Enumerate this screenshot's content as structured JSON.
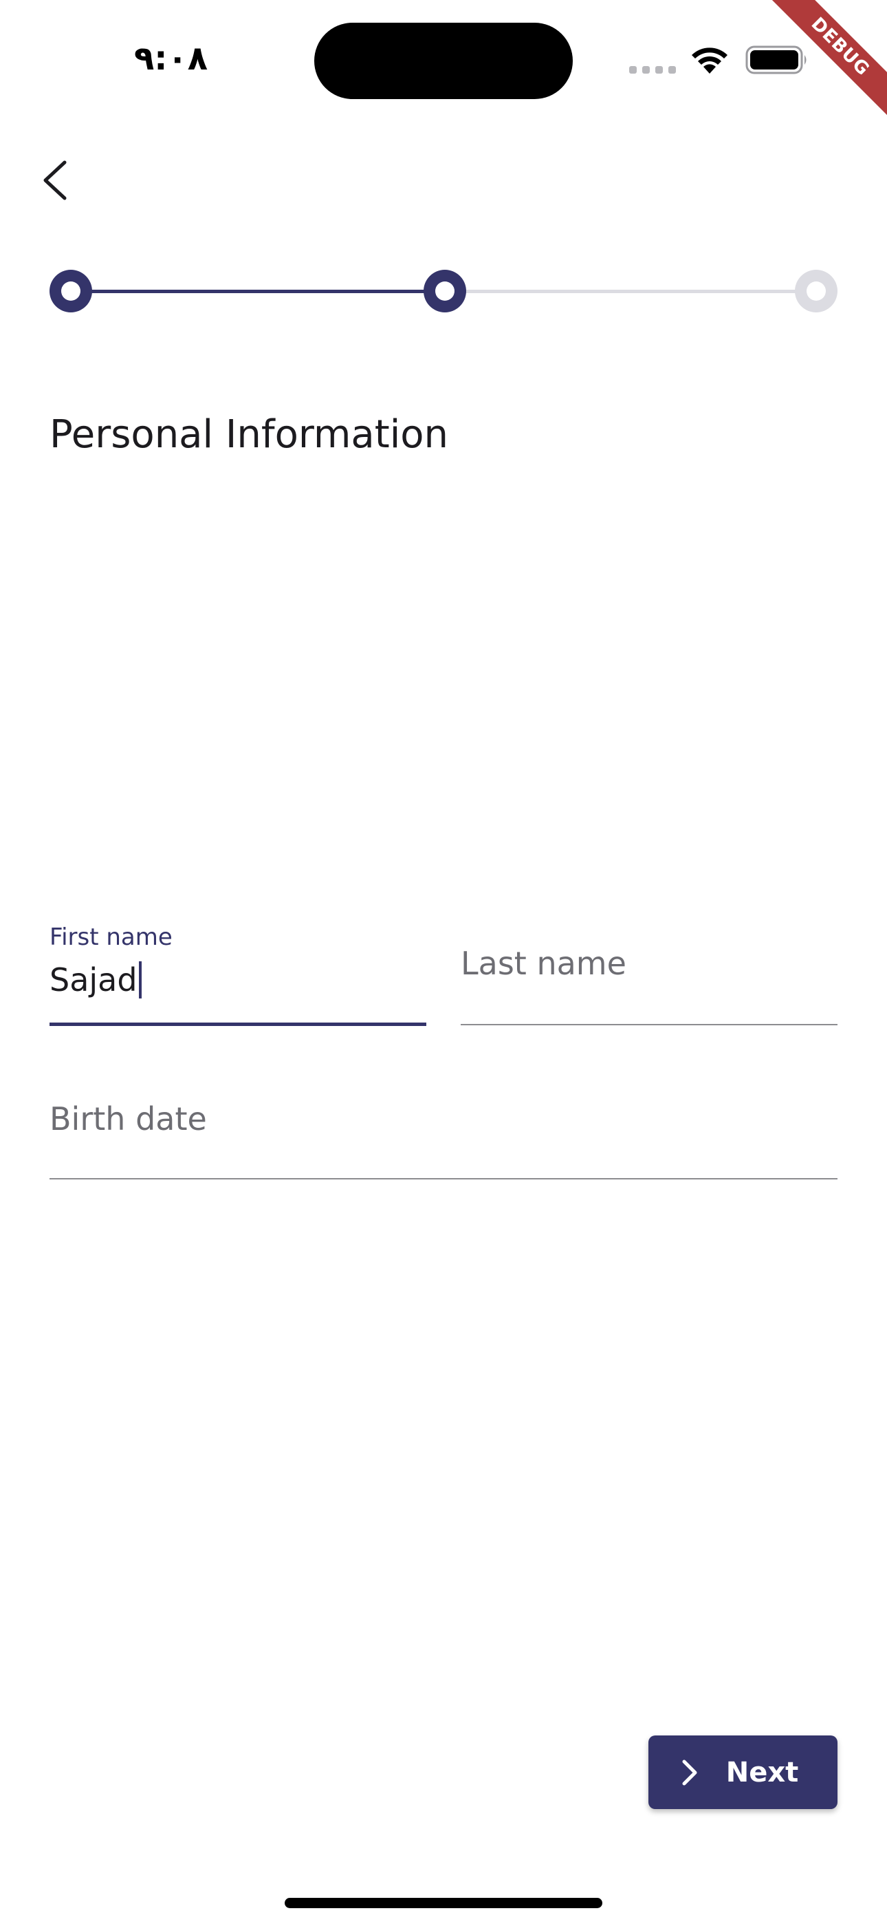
{
  "status_bar": {
    "time": "٩:٠٨",
    "debug_label": "DEBUG"
  },
  "stepper": {
    "total_steps": 3,
    "current_step": 2
  },
  "page": {
    "title": "Personal Information"
  },
  "form": {
    "first_name": {
      "label": "First name",
      "value": "Sajad"
    },
    "last_name": {
      "label": "Last name",
      "value": ""
    },
    "birth_date": {
      "label": "Birth date",
      "value": ""
    }
  },
  "actions": {
    "next_label": "Next"
  },
  "colors": {
    "primary": "#34346a",
    "inactive_step": "#dcdce2",
    "debug_ribbon": "#b03a3a"
  },
  "icons": {
    "back": "chevron-left-icon",
    "next": "chevron-right-icon",
    "wifi": "wifi-icon",
    "battery": "battery-icon",
    "signal": "cellular-signal-icon"
  }
}
